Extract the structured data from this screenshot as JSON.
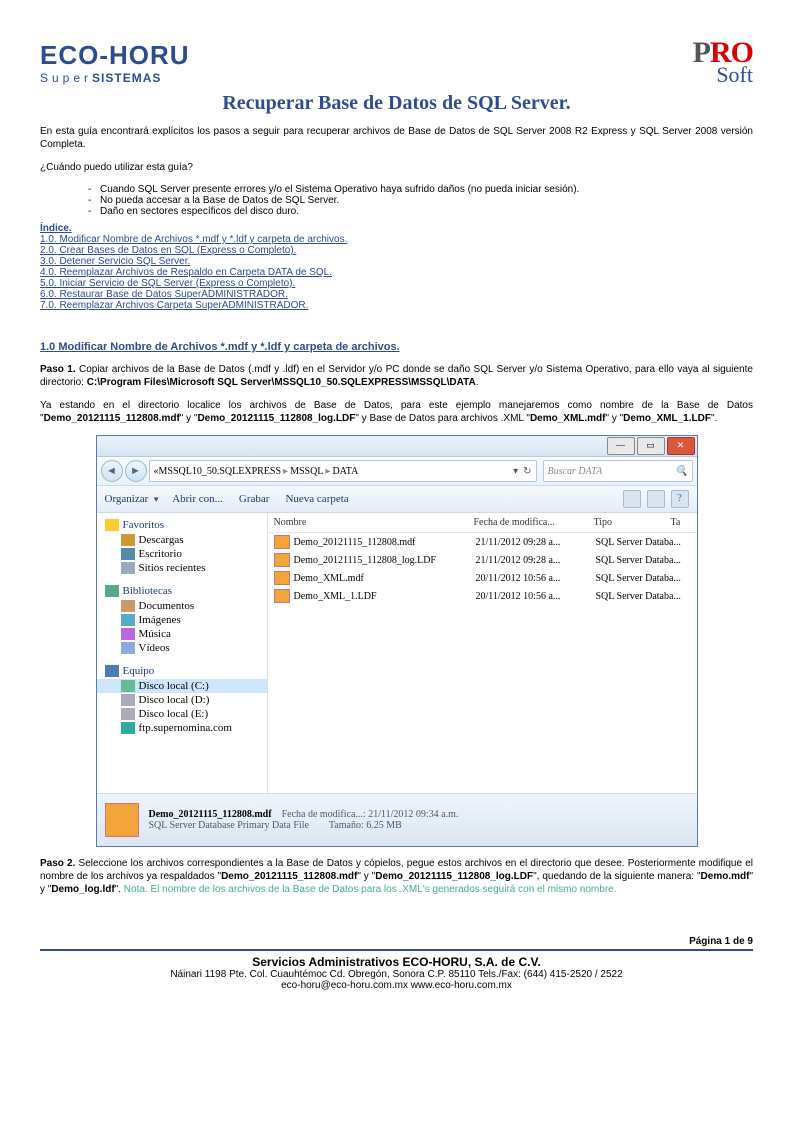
{
  "header": {
    "logo1_a": "ECO-",
    "logo1_b": "HORU",
    "logo1_sub1": "Super",
    "logo1_sub2": "SISTEMAS",
    "logo2_a": "P",
    "logo2_b": "R",
    "logo2_c": "O",
    "logo2_soft": "Soft"
  },
  "title": "Recuperar Base de Datos de SQL Server.",
  "intro": "En esta guía encontrará explícitos los pasos a seguir para recuperar archivos de Base de Datos de SQL Server 2008 R2 Express y SQL Server 2008 versión Completa.",
  "q": "¿Cuándo puedo utilizar esta guía?",
  "bullets": [
    "Cuando SQL Server presente errores y/o el Sistema Operativo haya sufrido daños (no pueda iniciar sesión).",
    "No pueda accesar a la Base de Datos de SQL Server.",
    "Daño en sectores específicos del disco duro."
  ],
  "indice": "Índice.",
  "toc": [
    "1.0.  Modificar Nombre de Archivos *.mdf y *.ldf y carpeta de archivos.",
    "2.0.  Crear Bases de Datos en SQL (Express o Completo).",
    "3.0.  Detener Servicio SQL Server.",
    "4.0.  Reemplazar Archivos de Respaldo en Carpeta DATA de SQL.",
    "5.0.  Iniciar Servicio de SQL Server (Express o Completo).",
    "6.0.  Restaurar Base de Datos SuperADMINISTRADOR.",
    "7.0.  Reemplazar Archivos Carpeta SuperADMINISTRADOR."
  ],
  "section1": "1.0 Modificar Nombre de Archivos *.mdf y *.ldf y carpeta de archivos.",
  "p1a": "Paso 1.",
  "p1b": " Copiar archivos de la Base de Datos (.mdf y .ldf) en el Servidor y/o PC donde se daño SQL Server y/o Sistema Operativo, para ello vaya al siguiente directorio: ",
  "p1c": "C:\\Program Files\\Microsoft SQL Server\\MSSQL10_50.SQLEXPRESS\\MSSQL\\DATA",
  "p2a": "Ya estando en el directorio localice los archivos de Base de Datos, para este ejemplo manejaremos como nombre de la Base de Datos \"",
  "p2b": "Demo_20121115_112808.mdf",
  "p2c": "\" y \"",
  "p2d": "Demo_20121115_112808_log.LDF",
  "p2e": "\" y Base de Datos para archivos .XML \"",
  "p2f": "Demo_XML.mdf",
  "p2g": "\" y \"",
  "p2h": "Demo_XML_1.LDF",
  "p2i": "\".",
  "win": {
    "crumb": [
      "MSSQL10_50.SQLEXPRESS",
      "MSSQL",
      "DATA"
    ],
    "search": "Buscar DATA",
    "toolbar": {
      "org": "Organizar",
      "open": "Abrir con...",
      "grab": "Grabar",
      "new": "Nueva carpeta"
    },
    "cols": {
      "n": "Nombre",
      "d": "Fecha de modifica...",
      "t": "Tipo",
      "s": "Ta"
    },
    "rows": [
      {
        "n": "Demo_20121115_112808.mdf",
        "d": "21/11/2012 09:28 a...",
        "t": "SQL Server Databa..."
      },
      {
        "n": "Demo_20121115_112808_log.LDF",
        "d": "21/11/2012 09:28 a...",
        "t": "SQL Server Databa..."
      },
      {
        "n": "Demo_XML.mdf",
        "d": "20/11/2012 10:56 a...",
        "t": "SQL Server Databa..."
      },
      {
        "n": "Demo_XML_1.LDF",
        "d": "20/11/2012 10:56 a...",
        "t": "SQL Server Databa..."
      }
    ],
    "side": {
      "fav": "Favoritos",
      "dl": "Descargas",
      "desk": "Escritorio",
      "rec": "Sitios recientes",
      "lib": "Bibliotecas",
      "doc": "Documentos",
      "img": "Imágenes",
      "mus": "Música",
      "vid": "Vídeos",
      "eq": "Equipo",
      "dc": "Disco local (C:)",
      "dd": "Disco local (D:)",
      "de": "Disco local (E:)",
      "ftp": "ftp.supernomina.com"
    },
    "det": {
      "name": "Demo_20121115_112808.mdf",
      "type": "SQL Server Database Primary Data File",
      "dlab": "Fecha de modifica...:",
      "dval": "21/11/2012 09:34 a.m.",
      "slab": "Tamaño:",
      "sval": "6.25 MB"
    }
  },
  "p3a": "Paso 2.",
  "p3b": " Seleccione los archivos correspondientes a la Base de Datos y cópielos, pegue estos archivos en el directorio que desee. Posteriormente modifique el nombre de los archivos ya respaldados \"",
  "p3c": "Demo_20121115_112808.mdf",
  "p3d": "\" y \"",
  "p3e": "Demo_20121115_112808_log.LDF",
  "p3f": "\", quedando de la siguiente manera: \"",
  "p3g": "Demo.mdf",
  "p3h": "\" y \"",
  "p3i": "Demo_log.ldf",
  "p3j": "\". ",
  "p3k": "Nota. El nombre de los archivos de la Base de Datos para los .XML's generados seguirá con el mismo nombre.",
  "footer": {
    "page": "Página 1 de 9",
    "company": "Servicios Administrativos ECO-HORU, S.A. de C.V.",
    "addr": "Náinari 1198 Pte.   Col. Cuauhtémoc   Cd. Obregón, Sonora   C.P. 85110   Tels./Fax: (644) 415-2520 / 2522",
    "mail": "eco-horu@eco-horu.com.mx     www.eco-horu.com.mx"
  }
}
